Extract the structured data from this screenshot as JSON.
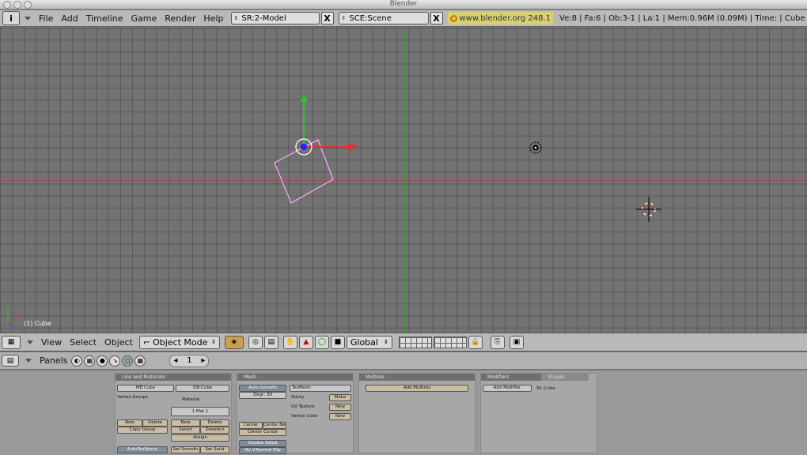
{
  "window": {
    "title": "Blender"
  },
  "info_header": {
    "icon_label": "i",
    "menus": [
      "File",
      "Add",
      "Timeline",
      "Game",
      "Render",
      "Help"
    ],
    "screen_field": "SR:2-Model",
    "scene_field": "SCE:Scene",
    "close_glyph": "X",
    "url": "www.blender.org 248.1",
    "stats": "Ve:8 | Fa:6 | Ob:3-1 | La:1  | Mem:0.96M (0.09M)  | Time: | Cube"
  },
  "viewport": {
    "object_label": "(1) Cube",
    "colors": {
      "grid_bg": "#737373",
      "x_axis": "#a05050",
      "y_axis": "#3a9a3a",
      "selection": "#ffaaff"
    }
  },
  "view3d_header": {
    "menus": [
      "View",
      "Select",
      "Object"
    ],
    "mode": "Object Mode",
    "orientation": "Global"
  },
  "buttons_header": {
    "panels_label": "Panels",
    "frame_number": "1",
    "arrow_left": "◂",
    "arrow_right": "▸"
  },
  "panels": {
    "link_materials": {
      "title": "Link and Materials",
      "me_field": "ME:Cube",
      "ob_field": "OB:Cube",
      "vertex_groups": "Vertex Groups",
      "material": "Material",
      "mat_count": "1 Mat 1",
      "new": "New",
      "delete": "Delete",
      "copy_group": "Copy Group",
      "new2": "New",
      "delete2": "Delete",
      "select": "Select",
      "deselect": "Deselect",
      "assign": "Assign",
      "autotexspace": "AutoTexSpace",
      "set_smooth": "Set Smooth",
      "set_solid": "Set Solid"
    },
    "mesh": {
      "title": "Mesh",
      "auto_smooth": "Auto Smooth",
      "degr": "Degr: 30",
      "tex_mesh": "TexMesh:",
      "sticky": "Sticky",
      "uv_texture": "UV Texture",
      "vertex_color": "Vertex Color",
      "make": "Make",
      "new": "New",
      "new2": "New",
      "center": "Center",
      "center_new": "Center New",
      "center_cursor": "Center Cursor",
      "double_sided": "Double Sided",
      "no_v_normal_flip": "No V.Normal Flip"
    },
    "multires": {
      "title": "Multires",
      "add_multires": "Add Multires"
    },
    "modifiers": {
      "tab_modifiers": "Modifiers",
      "tab_shapes": "Shapes",
      "add_modifier": "Add Modifier",
      "to": "To: Cube"
    }
  }
}
